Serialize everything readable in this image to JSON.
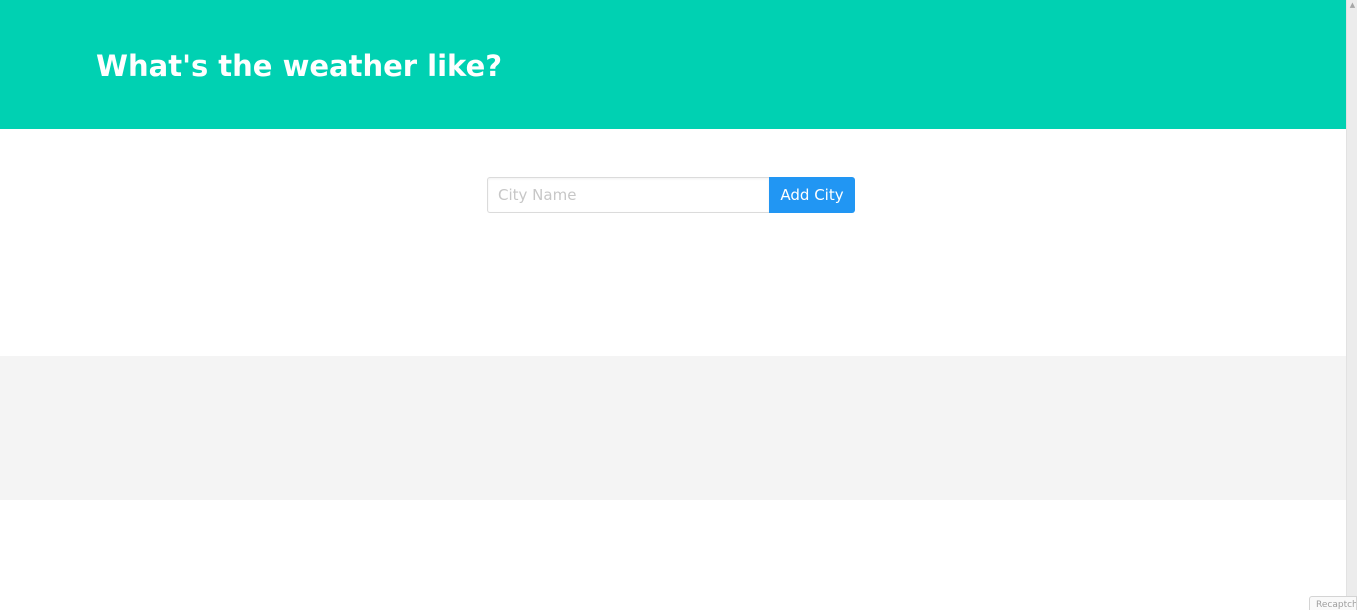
{
  "header": {
    "title": "What's the weather like?"
  },
  "city_form": {
    "input_placeholder": "City Name",
    "input_value": "",
    "add_button_label": "Add City"
  },
  "scrollbar": {
    "up_icon": "chevron-up-icon",
    "down_icon": "chevron-down-icon"
  },
  "corner_badge": {
    "label": "Recaptcha"
  },
  "colors": {
    "hero_background": "#00d1b2",
    "button_background": "#2196f3",
    "results_band_background": "#f4f4f4"
  }
}
